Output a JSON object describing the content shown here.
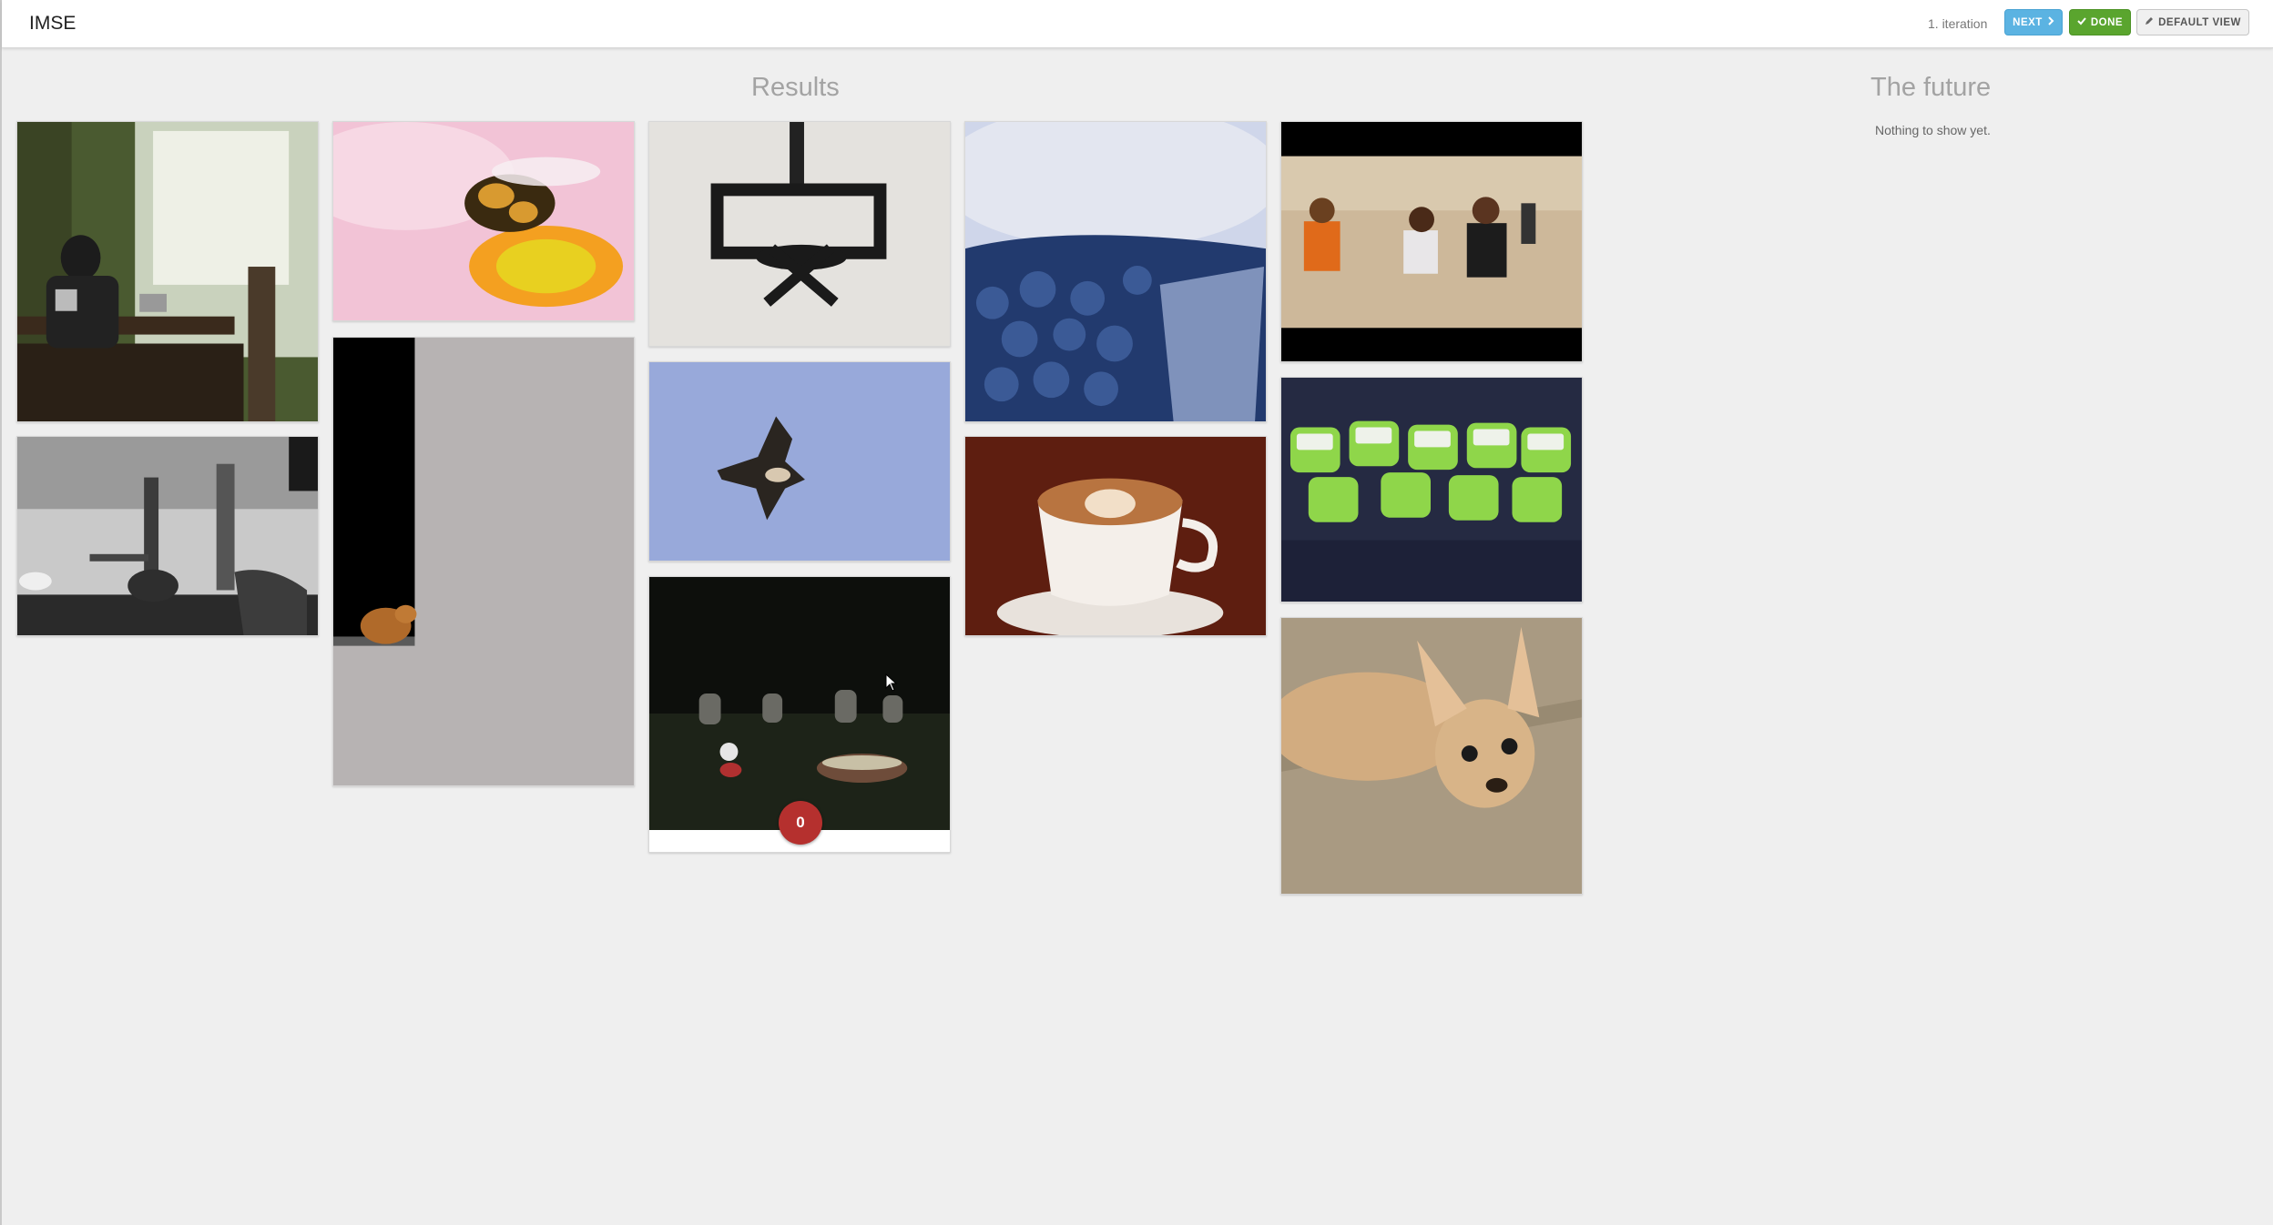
{
  "topbar": {
    "brand": "IMSE",
    "iteration": "1. iteration",
    "next_label": "NEXT",
    "done_label": "DONE",
    "default_view_label": "DEFAULT VIEW"
  },
  "results": {
    "title": "Results",
    "images": [
      {
        "subject": "man-sitting-at-cafe-table"
      },
      {
        "subject": "water-pipe-black-and-white"
      },
      {
        "subject": "bee-on-pink-flower"
      },
      {
        "subject": "cat-on-wall-ledge"
      },
      {
        "subject": "chairlift-shadow-on-snow"
      },
      {
        "subject": "hawk-in-blue-sky"
      },
      {
        "subject": "dark-graveyard",
        "rating": "0"
      },
      {
        "subject": "blueberries-in-cup"
      },
      {
        "subject": "latte-art-cup"
      },
      {
        "subject": "children-running-on-beach"
      },
      {
        "subject": "green-laptops-on-sofa"
      },
      {
        "subject": "chihuahua-dog"
      }
    ]
  },
  "future": {
    "title": "The future",
    "empty_text": "Nothing to show yet."
  }
}
